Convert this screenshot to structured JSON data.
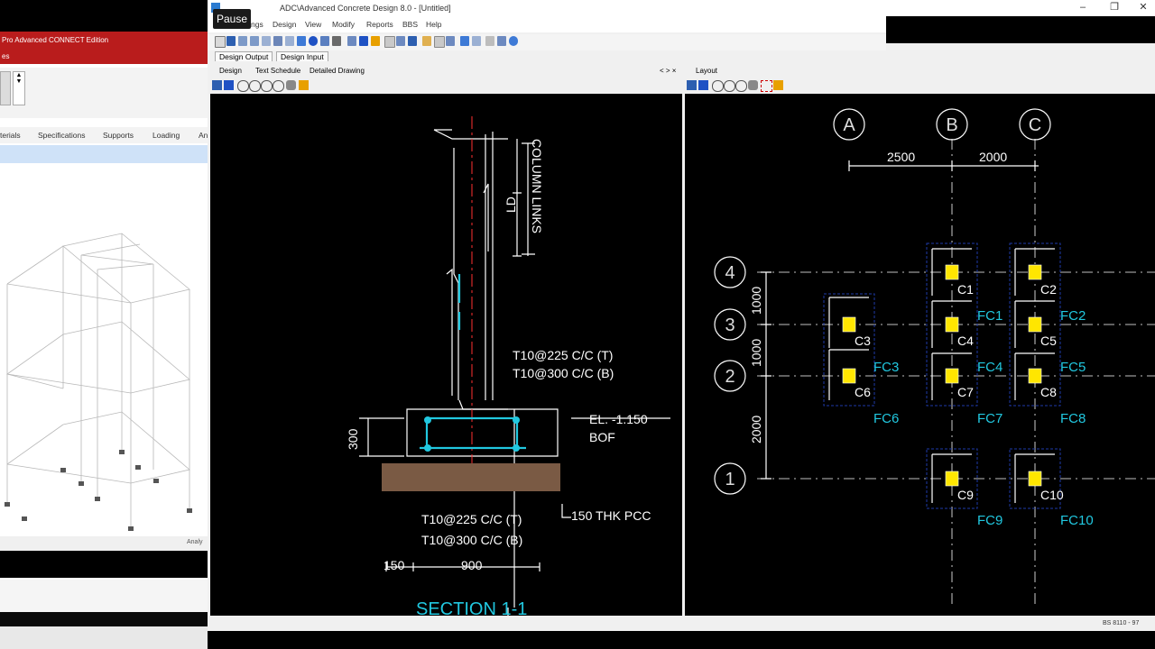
{
  "staad": {
    "title": "Pro Advanced CONNECT Edition",
    "menu_fragment": "es",
    "tabs": [
      "terials",
      "Specifications",
      "Supports",
      "Loading",
      "An"
    ],
    "status_right": "Analy"
  },
  "acd": {
    "title": "ADC\\Advanced Concrete Design 8.0 - [Untitled]",
    "menu": [
      "ngs",
      "Design",
      "View",
      "Modify",
      "Reports",
      "BBS",
      "Help"
    ],
    "doc_tabs": [
      "Design Output",
      "Design Input"
    ],
    "left_panel_tabs": [
      "Design",
      "Text Schedule",
      "Detailed Drawing"
    ],
    "left_panel_ctrl": "< > ×",
    "right_panel_tab": "Layout",
    "status_right": "BS 8110 - 97",
    "window_buttons": [
      "–",
      "❐",
      "✕"
    ]
  },
  "pause_label": "Pause",
  "section_drawing": {
    "labels": {
      "column_links": "COLUMN LINKS",
      "ld": "LD",
      "rebar_top_1": "T10@225 C/C (T)",
      "rebar_top_2": "T10@300 C/C (B)",
      "depth": "300",
      "el": "EL. -1.150",
      "bof": "BOF",
      "rebar_bot_1": "T10@225 C/C (T)",
      "rebar_bot_2": "T10@300 C/C (B)",
      "pcc": "150 THK PCC",
      "dim_150": "150",
      "dim_900": "900",
      "title": "SECTION 1-1"
    },
    "colors": {
      "cyan": "#21c8e0",
      "white": "#ffffff",
      "pcc": "#7a5a44",
      "red": "#ff3030"
    }
  },
  "layout_drawing": {
    "grid_letters": [
      "A",
      "B",
      "C"
    ],
    "grid_numbers": [
      "4",
      "3",
      "2",
      "1"
    ],
    "dims_top": [
      "2500",
      "2000"
    ],
    "dims_side": [
      "1000",
      "1000",
      "2000"
    ],
    "columns": [
      "C1",
      "C2",
      "C3",
      "C4",
      "C5",
      "C6",
      "C7",
      "C8",
      "C9",
      "C10"
    ],
    "footings": [
      "FC1",
      "FC2",
      "FC3",
      "FC4",
      "FC5",
      "FC6",
      "FC7",
      "FC8",
      "FC9",
      "FC10"
    ],
    "colors": {
      "column": "#ffe600",
      "footing_label": "#21c8e0",
      "outline": "#1e3aa8"
    }
  }
}
